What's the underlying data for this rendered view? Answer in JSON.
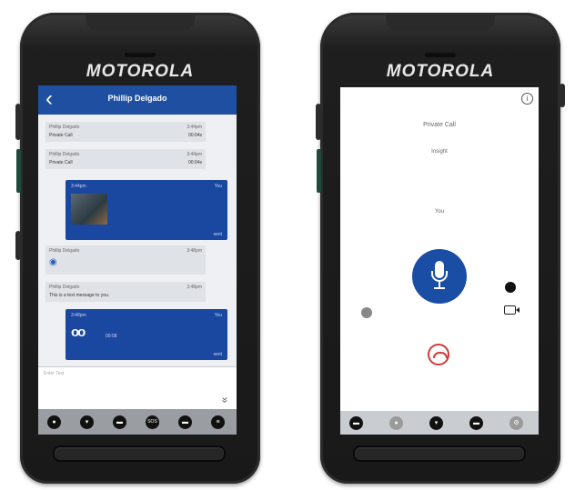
{
  "left_phone": {
    "brand": "MOTOROLA",
    "header": {
      "back_icon": "chevron-left-icon",
      "title": "Phillip Delgado"
    },
    "messages": [
      {
        "kind": "grey",
        "sender": "Phillip Delgado",
        "time": "3:44pm",
        "line2": "Private Call",
        "duration": "00:04s"
      },
      {
        "kind": "grey",
        "sender": "Phillip Delgado",
        "time": "3:44pm",
        "line2": "Private Call",
        "duration": "00:04s"
      },
      {
        "kind": "blue-image",
        "time": "3:44pm",
        "sender": "You",
        "footer": "sent"
      },
      {
        "kind": "grey-location",
        "sender": "Phillip Delgado",
        "time": "3:48pm",
        "icon": "location-pin-icon"
      },
      {
        "kind": "grey-text",
        "sender": "Phillip Delgado",
        "time": "3:48pm",
        "text": "This is a text message to you."
      },
      {
        "kind": "blue-voicemail",
        "time": "3:48pm",
        "sender": "You",
        "duration": "00:08",
        "icon": "voicemail-icon",
        "footer": "sent"
      }
    ],
    "reply_placeholder": "Enter Text",
    "expand_icon": "double-chevron-down-icon",
    "nav": [
      "contacts-icon",
      "location-icon",
      "chat-icon",
      "sos-icon",
      "radio-icon",
      "menu-icon"
    ]
  },
  "right_phone": {
    "brand": "MOTOROLA",
    "info_icon": "info-icon",
    "call_type": "Private Call",
    "status": "Insight",
    "speaker_label": "You",
    "ptt_icon": "microphone-icon",
    "hangup_icon": "hang-up-icon",
    "left_icon": "volume-icon",
    "right_icons": [
      "speaker-icon",
      "video-camera-icon"
    ],
    "nav": [
      "chat-icon",
      "contacts-icon",
      "location-icon",
      "radio-icon",
      "settings-icon"
    ]
  }
}
